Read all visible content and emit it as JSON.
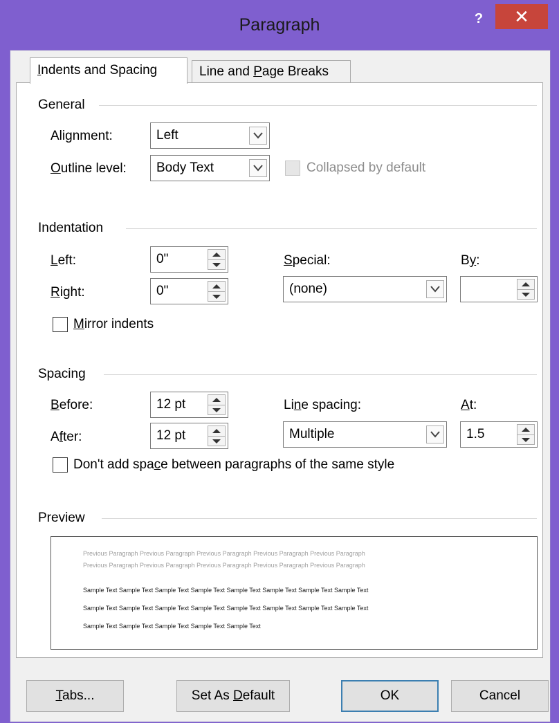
{
  "dialog": {
    "title": "Paragraph",
    "help_label": "?",
    "close_label": "✕"
  },
  "tabs": [
    {
      "pre": "",
      "key": "I",
      "post": "ndents and Spacing",
      "active": true
    },
    {
      "pre": "Line and ",
      "key": "P",
      "post": "age Breaks",
      "active": false
    }
  ],
  "general": {
    "section_label": "General",
    "alignment": {
      "pre": "Ali",
      "key": "g",
      "post": "nment:",
      "value": "Left"
    },
    "outline_level": {
      "pre": "",
      "key": "O",
      "post": "utline level:",
      "value": "Body Text"
    },
    "collapsed_label": "Collapsed by default",
    "collapsed_checked": false,
    "collapsed_enabled": false
  },
  "indentation": {
    "section_label": "Indentation",
    "left": {
      "pre": "",
      "key": "L",
      "post": "eft:",
      "value": "0\""
    },
    "right": {
      "pre": "",
      "key": "R",
      "post": "ight:",
      "value": "0\""
    },
    "special": {
      "pre": "",
      "key": "S",
      "post": "pecial:",
      "value": "(none)"
    },
    "by": {
      "pre": "B",
      "key": "y",
      "post": ":",
      "value": ""
    },
    "mirror": {
      "pre": "",
      "key": "M",
      "post": "irror indents",
      "checked": false
    }
  },
  "spacing": {
    "section_label": "Spacing",
    "before": {
      "pre": "",
      "key": "B",
      "post": "efore:",
      "value": "12 pt"
    },
    "after": {
      "pre": "A",
      "key": "f",
      "post": "ter:",
      "value": "12 pt"
    },
    "line_spacing": {
      "pre": "Li",
      "key": "n",
      "post": "e spacing:",
      "value": "Multiple"
    },
    "at": {
      "pre": "",
      "key": "A",
      "post": "t:",
      "value": "1.5"
    },
    "dont_add": {
      "pre": "Don't add spa",
      "key": "c",
      "post": "e between paragraphs of the same style",
      "checked": false
    }
  },
  "preview": {
    "section_label": "Preview",
    "previous_lines": [
      "Previous Paragraph Previous Paragraph Previous Paragraph Previous Paragraph Previous Paragraph",
      "Previous Paragraph Previous Paragraph Previous Paragraph Previous Paragraph Previous Paragraph"
    ],
    "sample_lines": [
      "Sample Text Sample Text Sample Text Sample Text Sample Text Sample Text Sample Text Sample Text",
      "Sample Text Sample Text Sample Text Sample Text Sample Text Sample Text Sample Text Sample Text",
      "Sample Text Sample Text Sample Text Sample Text Sample Text"
    ]
  },
  "buttons": {
    "tabs": {
      "pre": "",
      "key": "T",
      "post": "abs..."
    },
    "set_default": {
      "pre": "Set As ",
      "key": "D",
      "post": "efault"
    },
    "ok": {
      "pre": "OK",
      "key": "",
      "post": ""
    },
    "cancel": {
      "pre": "Cancel",
      "key": "",
      "post": ""
    }
  },
  "colors": {
    "title_bar": "#7f5fcf",
    "close_button": "#c7453b",
    "default_button_border": "#3c7fb1"
  }
}
